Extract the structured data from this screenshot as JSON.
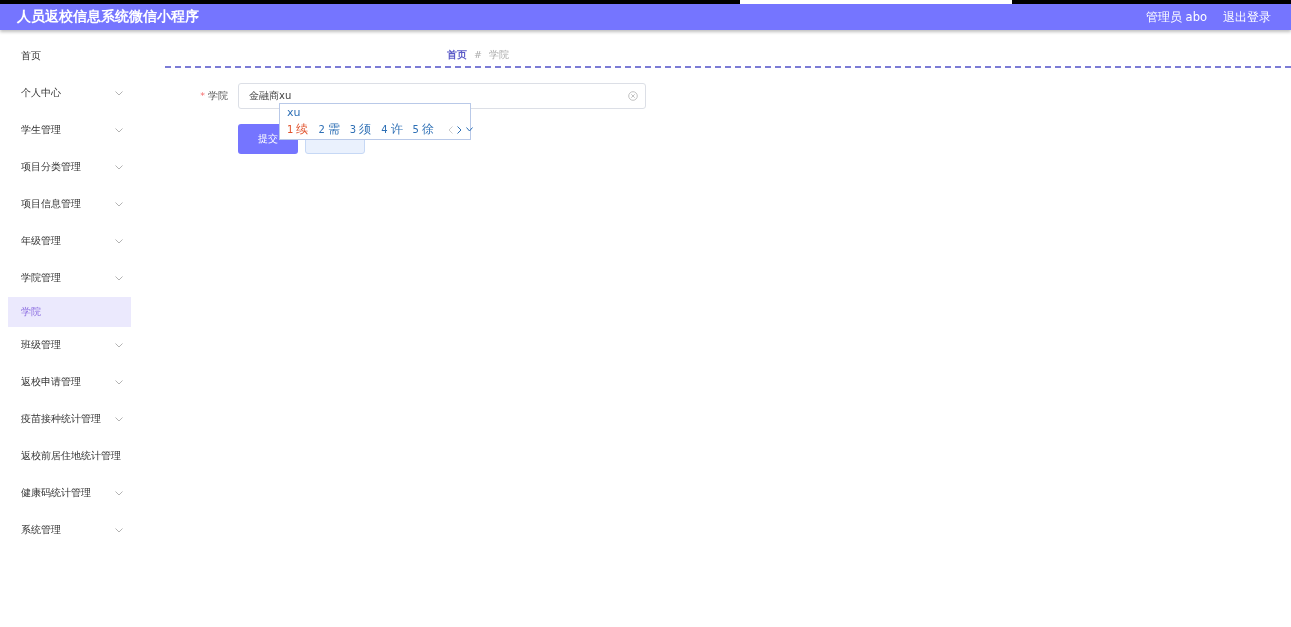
{
  "header": {
    "title": "人员返校信息系统微信小程序",
    "user": "管理员 abo",
    "logout": "退出登录"
  },
  "sidebar": {
    "items": [
      {
        "label": "首页",
        "kind": "link"
      },
      {
        "label": "个人中心",
        "kind": "submenu"
      },
      {
        "label": "学生管理",
        "kind": "submenu"
      },
      {
        "label": "项目分类管理",
        "kind": "submenu"
      },
      {
        "label": "项目信息管理",
        "kind": "submenu"
      },
      {
        "label": "年级管理",
        "kind": "submenu"
      },
      {
        "label": "学院管理",
        "kind": "submenu",
        "children": [
          {
            "label": "学院",
            "selected": true
          }
        ]
      },
      {
        "label": "班级管理",
        "kind": "submenu"
      },
      {
        "label": "返校申请管理",
        "kind": "submenu"
      },
      {
        "label": "疫苗接种统计管理",
        "kind": "submenu"
      },
      {
        "label": "返校前居住地统计管理",
        "kind": "link"
      },
      {
        "label": "健康码统计管理",
        "kind": "submenu"
      },
      {
        "label": "系统管理",
        "kind": "submenu"
      }
    ]
  },
  "breadcrumb": [
    {
      "label": "首页"
    },
    {
      "label": "学院"
    }
  ],
  "breadcrumb_separator": "#",
  "form": {
    "fields": [
      {
        "label": "学院",
        "required": true,
        "required_mark": "*",
        "value": "金融商xu"
      }
    ],
    "buttons": [
      {
        "label": "提交",
        "kind": "primary"
      },
      {
        "kind": "secondary"
      }
    ]
  },
  "ime": {
    "composition": "xu",
    "candidates": [
      {
        "number": "1",
        "text": "续",
        "selected": true
      },
      {
        "number": "2",
        "text": "需",
        "selected": false
      },
      {
        "number": "3",
        "text": "须",
        "selected": false
      },
      {
        "number": "4",
        "text": "许",
        "selected": false
      },
      {
        "number": "5",
        "text": "徐",
        "selected": false
      }
    ]
  }
}
